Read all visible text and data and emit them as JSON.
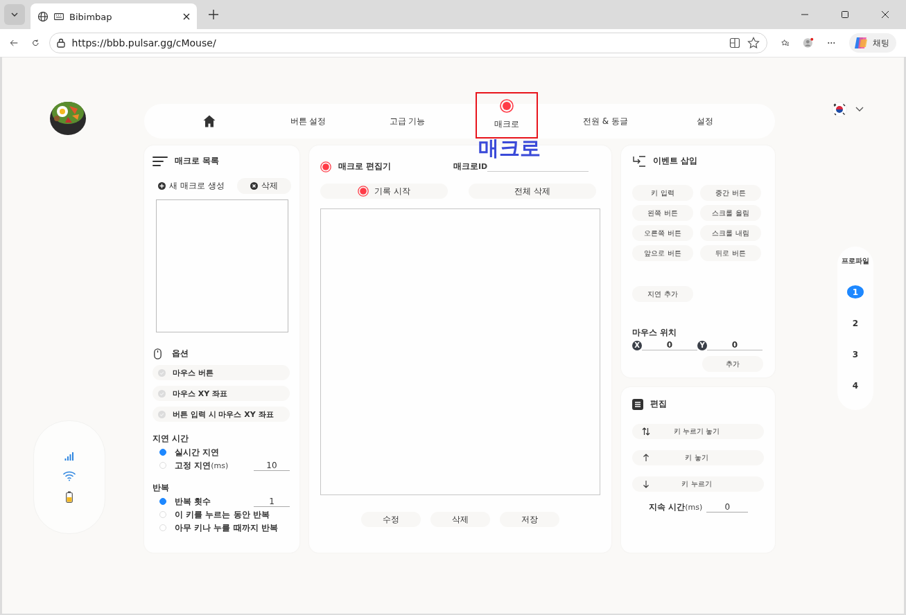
{
  "browser": {
    "tab_title": "Bibimbap",
    "url": "https://bbb.pulsar.gg/cMouse/",
    "chat_button": "채팅"
  },
  "nav": {
    "items": [
      {
        "kind": "home",
        "selected": false
      },
      {
        "kind": "text",
        "label": "버튼 설정",
        "selected": false
      },
      {
        "kind": "text",
        "label": "고급 기능",
        "selected": false
      },
      {
        "kind": "text",
        "label": "매크로",
        "selected": true
      },
      {
        "kind": "text",
        "label": "전원 & 동글",
        "selected": false
      },
      {
        "kind": "text",
        "label": "설정",
        "selected": false
      }
    ]
  },
  "annotation": {
    "label": "매크로"
  },
  "macro_list": {
    "title": "매크로 목록",
    "buttons": [
      {
        "kind": "add",
        "label": "새 매크로 생성"
      },
      {
        "kind": "delete",
        "label": "삭제"
      }
    ]
  },
  "options": {
    "title": "옵션",
    "items": [
      {
        "label": "마우스 버튼",
        "checked": false
      },
      {
        "label": "마우스 XY 좌표",
        "checked": false
      },
      {
        "label": "버튼 입력 시 마우스 XY 좌표",
        "checked": false
      }
    ]
  },
  "delay": {
    "title": "지연 시간",
    "items": [
      {
        "label": "실시간 지연",
        "selected": true
      },
      {
        "label": "고정 지연",
        "unit": "(ms)",
        "value": "10",
        "selected": false
      }
    ]
  },
  "repeat": {
    "title": "반복",
    "items": [
      {
        "label": "반복 횟수",
        "value": "1",
        "selected": true
      },
      {
        "label": "이 키를 누르는 동안 반복",
        "selected": false
      },
      {
        "label": "아무 키나 누를 때까지 반복",
        "selected": false
      }
    ]
  },
  "editor": {
    "title": "매크로 편집기",
    "id_label": "매크로",
    "id_unit": "ID",
    "record_button": "기록 시작",
    "clear_button": "전체 삭제",
    "footer_buttons": [
      "수정",
      "삭제",
      "저장"
    ]
  },
  "events": {
    "title": "이벤트 삽입",
    "buttons": [
      "키 입력",
      "중간 버튼",
      "왼쪽 버튼",
      "스크롤 올림",
      "오른쪽 버튼",
      "스크롤 내림",
      "앞으로 버튼",
      "뒤로 버튼"
    ],
    "delay_button": "지연 추가",
    "mouse_position": {
      "title": "마우스 위치",
      "x_label": "X",
      "x_value": "0",
      "y_label": "Y",
      "y_value": "0",
      "add_button": "추가"
    }
  },
  "edit": {
    "title": "편집",
    "buttons": [
      {
        "kind": "updown",
        "label": "키 누르기 놓기"
      },
      {
        "kind": "up",
        "label": "키 놓기"
      },
      {
        "kind": "down",
        "label": "키 누르기"
      }
    ],
    "duration_label": "지속 시간",
    "duration_unit": "(ms)",
    "duration_value": "0"
  },
  "profiles": {
    "title": "프로파일",
    "items": [
      {
        "label": "1",
        "selected": true
      },
      {
        "label": "2",
        "selected": false
      },
      {
        "label": "3",
        "selected": false
      },
      {
        "label": "4",
        "selected": false
      }
    ]
  }
}
